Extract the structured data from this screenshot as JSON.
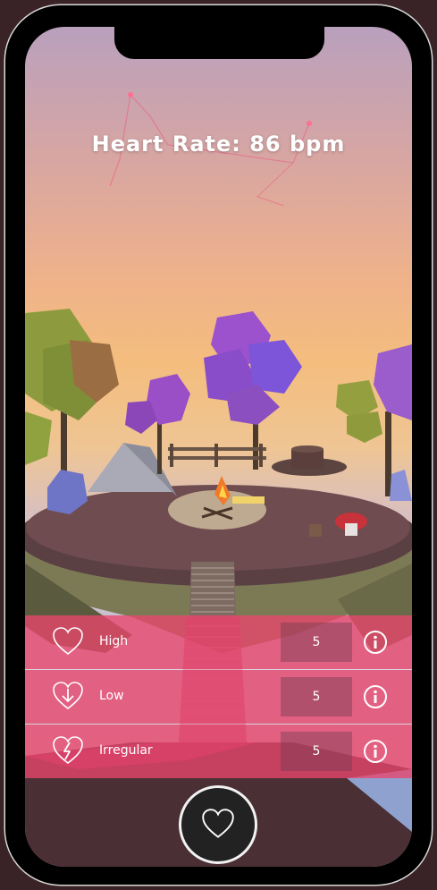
{
  "header": {
    "title": "Heart Rate: 86 bpm"
  },
  "alerts": [
    {
      "label": "High",
      "value": "5",
      "icon": "heart-outline-icon"
    },
    {
      "label": "Low",
      "value": "5",
      "icon": "heart-down-arrow-icon"
    },
    {
      "label": "Irregular",
      "value": "5",
      "icon": "heart-lightning-icon"
    }
  ],
  "fab": {
    "icon": "heart-icon"
  }
}
